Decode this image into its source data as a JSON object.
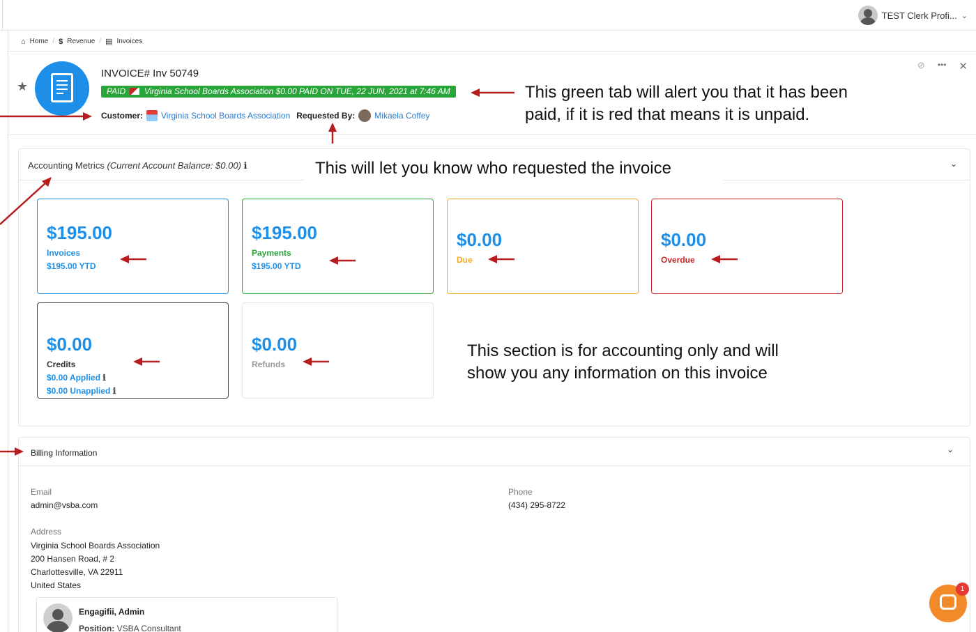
{
  "topbar": {
    "user_label": "TEST Clerk Profi...",
    "user_caret": "⌄"
  },
  "breadcrumb": {
    "items": [
      {
        "icon": "home-icon",
        "glyph": "⌂",
        "label": "Home"
      },
      {
        "icon": "dollar-icon",
        "glyph": "$",
        "label": "Revenue"
      },
      {
        "icon": "invoice-icon",
        "glyph": "▤",
        "label": "Invoices"
      }
    ],
    "separator": "/"
  },
  "invoice": {
    "title": "INVOICE# Inv 50749",
    "status_tag_prefix": "PAID",
    "status_tag_text": "Virginia School Boards Association $0.00 PAID ON TUE, 22 JUN, 2021 at 7:46 AM",
    "status_color": "#2aa53a",
    "customer_label": "Customer:",
    "customer_name": "Virginia School Boards Association",
    "requested_label": "Requested By:",
    "requested_name": "Mikaela Coffey"
  },
  "header_actions": {
    "hide": "⊘",
    "more": "•••",
    "close": "✕"
  },
  "annotations": {
    "paid_note_line1": "This green tab will alert you that it has been",
    "paid_note_line2": "paid, if it is red that means it is unpaid.",
    "requested_note": "This will let you know who requested the invoice",
    "section_note_line1": "This section is for accounting only and will",
    "section_note_line2": "show you any information on this invoice",
    "arrow_color": "#b71c1c"
  },
  "metrics": {
    "heading": "Accounting Metrics",
    "balance_note": "(Current Account Balance: $0.00)",
    "info_glyph": "ℹ",
    "collapse_glyph": "⌄",
    "invoices": {
      "amount": "$195.00",
      "label": "Invoices",
      "sub": "$195.00   YTD",
      "color": "#1e8fe8"
    },
    "payments": {
      "amount": "$195.00",
      "label": "Payments",
      "sub": "$195.00   YTD",
      "amount_color": "#1e8fe8",
      "label_color": "#2aa53a",
      "sub_color": "#1e8fe8"
    },
    "due": {
      "amount": "$0.00",
      "label": "Due",
      "amount_color": "#1e8fe8",
      "label_color": "#f5a623"
    },
    "overdue": {
      "amount": "$0.00",
      "label": "Overdue",
      "amount_color": "#1e8fe8",
      "label_color": "#c62828"
    },
    "credits": {
      "amount": "$0.00",
      "label": "Credits",
      "applied": "$0.00 Applied",
      "unapplied": "$0.00 Unapplied"
    },
    "refunds": {
      "amount": "$0.00",
      "label": "Refunds"
    }
  },
  "billing": {
    "heading": "Billing Information",
    "collapse_glyph": "⌄",
    "email_label": "Email",
    "email_value": "admin@vsba.com",
    "phone_label": "Phone",
    "phone_value": "(434) 295-8722",
    "address_label": "Address",
    "address_lines": [
      "Virginia School Boards Association",
      "200 Hansen Road, # 2",
      "Charlottesville, VA 22911",
      "United States"
    ],
    "contact_name": "Engagifii, Admin",
    "contact_position_label": "Position:",
    "contact_position_value": "VSBA Consultant"
  },
  "chat": {
    "badge": "1"
  }
}
